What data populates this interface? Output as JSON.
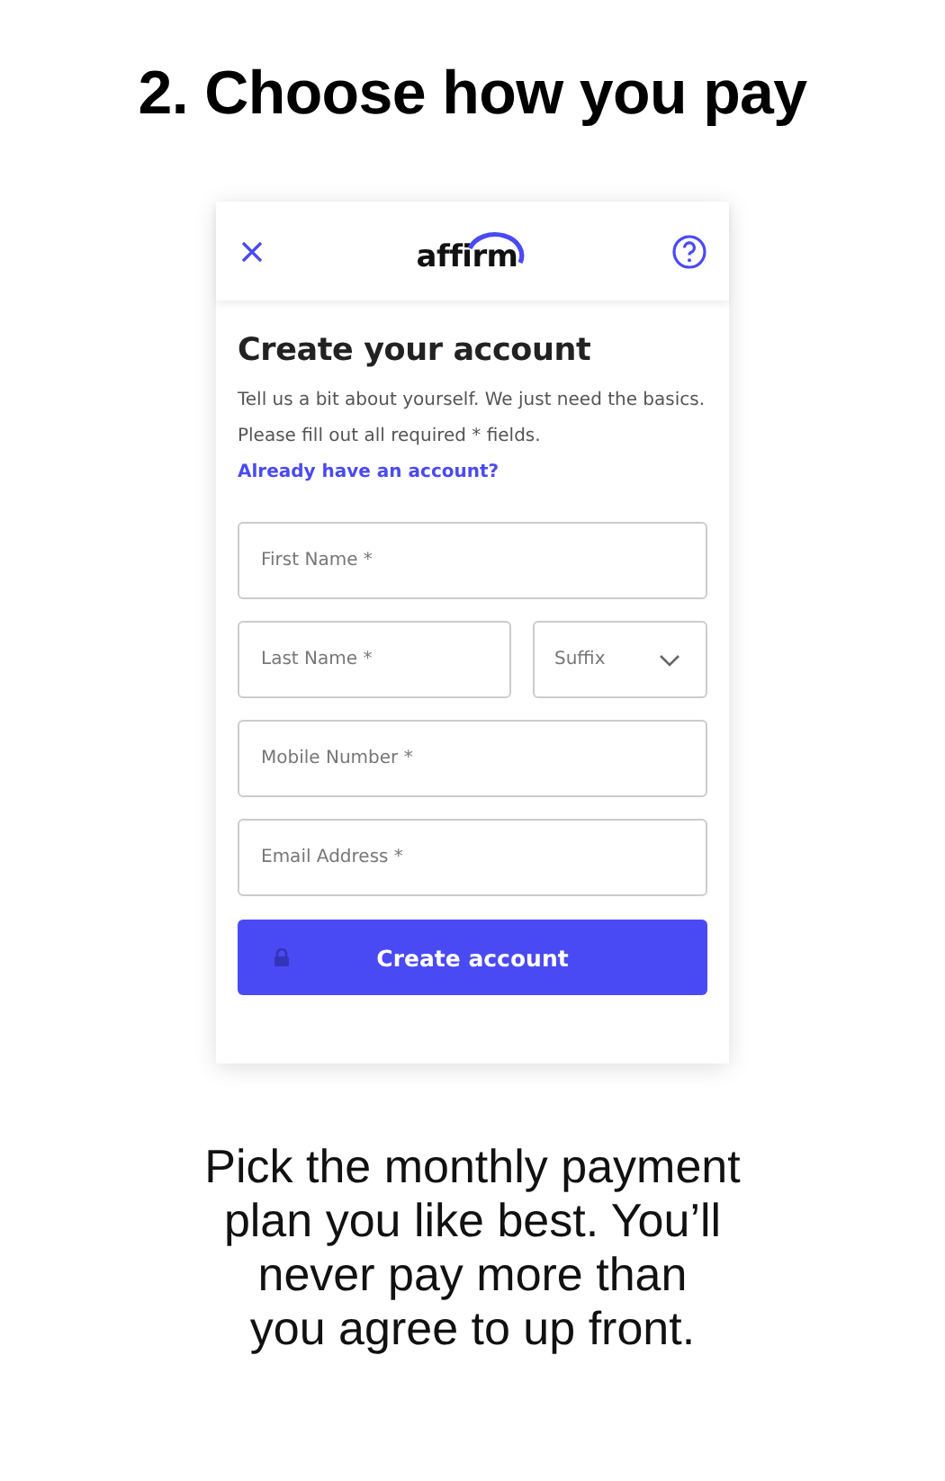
{
  "heading": "2. Choose how you pay",
  "card": {
    "logo": "affirm",
    "title": "Create your account",
    "intro": "Tell us a bit about yourself. We just need the basics. Please fill out all required * fields.",
    "link": "Already have an account?",
    "rows": [
      [
        {
          "kind": "text",
          "placeholder": "First Name *"
        }
      ],
      [
        {
          "kind": "text",
          "placeholder": "Last Name *"
        },
        {
          "kind": "select",
          "placeholder": "Suffix"
        }
      ],
      [
        {
          "kind": "text",
          "placeholder": "Mobile Number *"
        }
      ],
      [
        {
          "kind": "text",
          "placeholder": "Email Address *"
        }
      ]
    ],
    "button": "Create account"
  },
  "caption": [
    "Pick the monthly payment",
    "plan you like best. You’ll",
    "never pay more than",
    "you agree to up front."
  ]
}
